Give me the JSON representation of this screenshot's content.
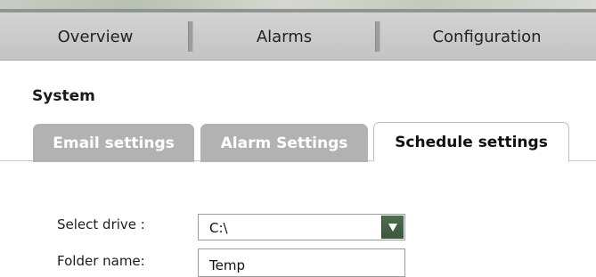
{
  "nav": {
    "overview": "Overview",
    "alarms": "Alarms",
    "configuration": "Configuration"
  },
  "section": {
    "title": "System"
  },
  "tabs": [
    {
      "label": "Email settings",
      "active": false
    },
    {
      "label": "Alarm Settings",
      "active": false
    },
    {
      "label": "Schedule settings",
      "active": true
    }
  ],
  "form": {
    "drive_label": "Select drive :",
    "drive_value": "C:\\",
    "folder_label": "Folder name:",
    "folder_value": "Temp"
  },
  "colors": {
    "navbar": "#c4c4c4",
    "inactive_tab": "#b2b2b2",
    "dropdown_button": "#3c573c"
  },
  "icons": {
    "dropdown": "triangle-down-icon"
  }
}
